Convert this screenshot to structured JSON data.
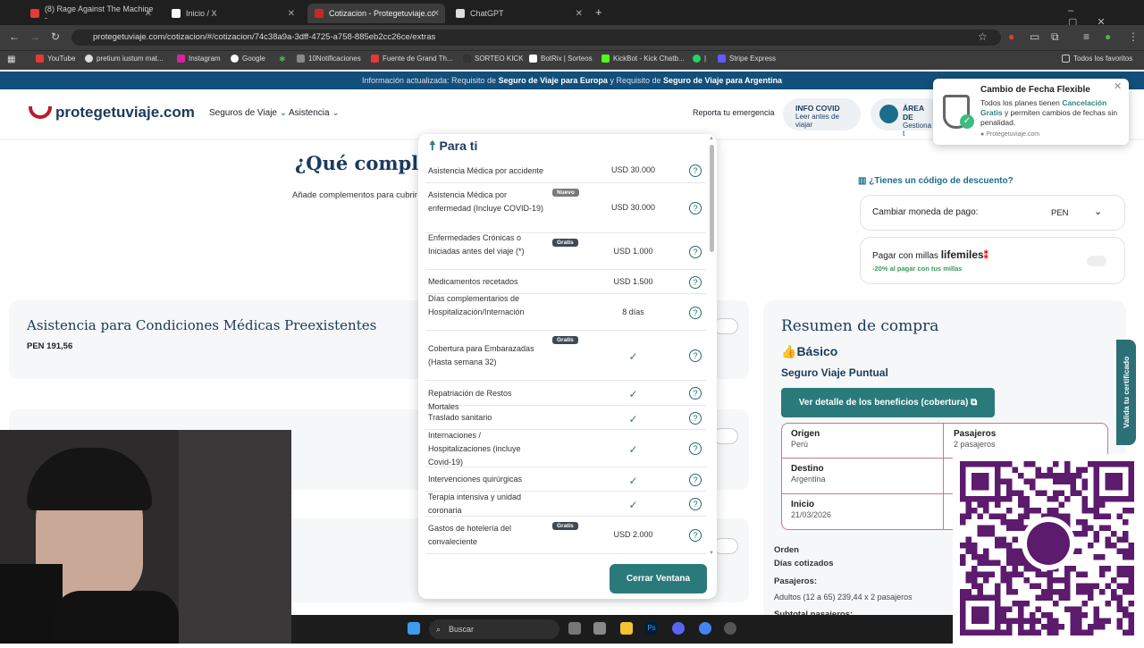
{
  "browser": {
    "tabs": [
      {
        "label": "(8) Rage Against The Machine -",
        "color": "#e53935"
      },
      {
        "label": "Inicio / X",
        "color": "#ffffff"
      },
      {
        "label": "Cotizacion - Protegetuviaje.com",
        "color": "#c62828"
      },
      {
        "label": "ChatGPT",
        "color": "#dddddd"
      }
    ],
    "url": "protegetuviaje.com/cotizacion/#/cotizacion/74c38a9a-3dff-4725-a758-885eb2cc26ce/extras",
    "bookmarks": [
      "YouTube",
      "pretium iustum mat...",
      "Instagram",
      "Google",
      "10Notificaciones",
      "Fuente de Grand Th...",
      "SORTEO KICK",
      "BotRix | Sorteos",
      "KickBot - Kick Chatb...",
      "|",
      "Stripe Express"
    ],
    "all_bookmarks": "Todos los favoritos"
  },
  "site": {
    "info_bar": {
      "prefix": "Información actualizada: Requisito de ",
      "b1": "Seguro de Viaje para Europa",
      "mid": " y Requisito de ",
      "b2": "Seguro de Viaje para Argentina"
    },
    "logo": "protegetuviaje.com",
    "nav": {
      "seguros": "Seguros de Viaje",
      "asistencia": "Asistencia",
      "emergencia": "Reporta tu emergencia"
    },
    "covid": {
      "title": "INFO COVID",
      "sub": "Leer antes de viajar"
    },
    "area": {
      "title": "ÁREA DE",
      "sub": "Gestiona t"
    },
    "heading": "¿Qué complem",
    "subheading": "Añade complementos para cubrir",
    "card1": {
      "title": "Asistencia para Condiciones Médicas Preexistentes",
      "price": "PEN 191,56"
    },
    "discount": "¿Tienes un código de descuento?",
    "currency": {
      "label": "Cambiar moneda de pago:",
      "value": "PEN"
    },
    "miles": {
      "label": "Pagar con millas",
      "brand": "lifemiles",
      "sub": "-20% al pagar con tus millas"
    },
    "valida": "Valida tu certificado"
  },
  "modal": {
    "title": "Para ti",
    "rows": [
      {
        "label": "Asistencia Médica por accidente",
        "value": "USD 30.000",
        "badge": ""
      },
      {
        "label": "Asistencia Médica por enfermedad (Incluye COVID-19)",
        "value": "USD 30.000",
        "badge": "Nuevo"
      },
      {
        "label": "Enfermedades Crónicas o Iniciadas antes del viaje (*)",
        "value": "USD 1.000",
        "badge": "Gratis"
      },
      {
        "label": "Medicamentos recetados",
        "value": "USD 1.500",
        "badge": ""
      },
      {
        "label": "Días complementarios de Hospitalización/Internación",
        "value": "8 días",
        "badge": ""
      },
      {
        "label": "Cobertura para Embarazadas (Hasta semana 32)",
        "value": "✓",
        "badge": "Gratis"
      },
      {
        "label": "Repatriación de Restos Mortales",
        "value": "✓",
        "badge": ""
      },
      {
        "label": "Traslado sanitario",
        "value": "✓",
        "badge": ""
      },
      {
        "label": "Internaciones / Hospitalizaciones (incluye Covid-19)",
        "value": "✓",
        "badge": ""
      },
      {
        "label": "Intervenciones quirúrgicas",
        "value": "✓",
        "badge": ""
      },
      {
        "label": "Terapia intensiva y unidad coronaria",
        "value": "✓",
        "badge": ""
      },
      {
        "label": "Gastos de hotelería del convaleciente",
        "value": "USD 2.000",
        "badge": "Gratis"
      }
    ],
    "close": "Cerrar Ventana"
  },
  "summary": {
    "title": "Resumen de compra",
    "plan": "Básico",
    "product": "Seguro Viaje Puntual",
    "detail_btn": "Ver detalle de los beneficios (cobertura)",
    "origen": {
      "label": "Origen",
      "value": "Perú"
    },
    "pasajeros": {
      "label": "Pasajeros",
      "value": "2 pasajeros"
    },
    "destino": {
      "label": "Destino",
      "value": "Argentina"
    },
    "inicio": {
      "label": "Inicio",
      "value": "21/03/2026"
    },
    "orden": "Orden",
    "dias": "Días cotizados",
    "pas_label": "Pasajeros:",
    "adultos": "Adultos (12 a 65) 239,44 x 2 pasajeros",
    "subtotal": "Subtotal pasajeros:"
  },
  "toast": {
    "title": "Cambio de Fecha Flexible",
    "p1": "Todos los planes tienen ",
    "link": "Cancelación Gratis",
    "p2": " y permiten cambios de fechas sin penalidad.",
    "source": "Protegetuviaje.com"
  },
  "taskbar": {
    "search": "Buscar"
  }
}
